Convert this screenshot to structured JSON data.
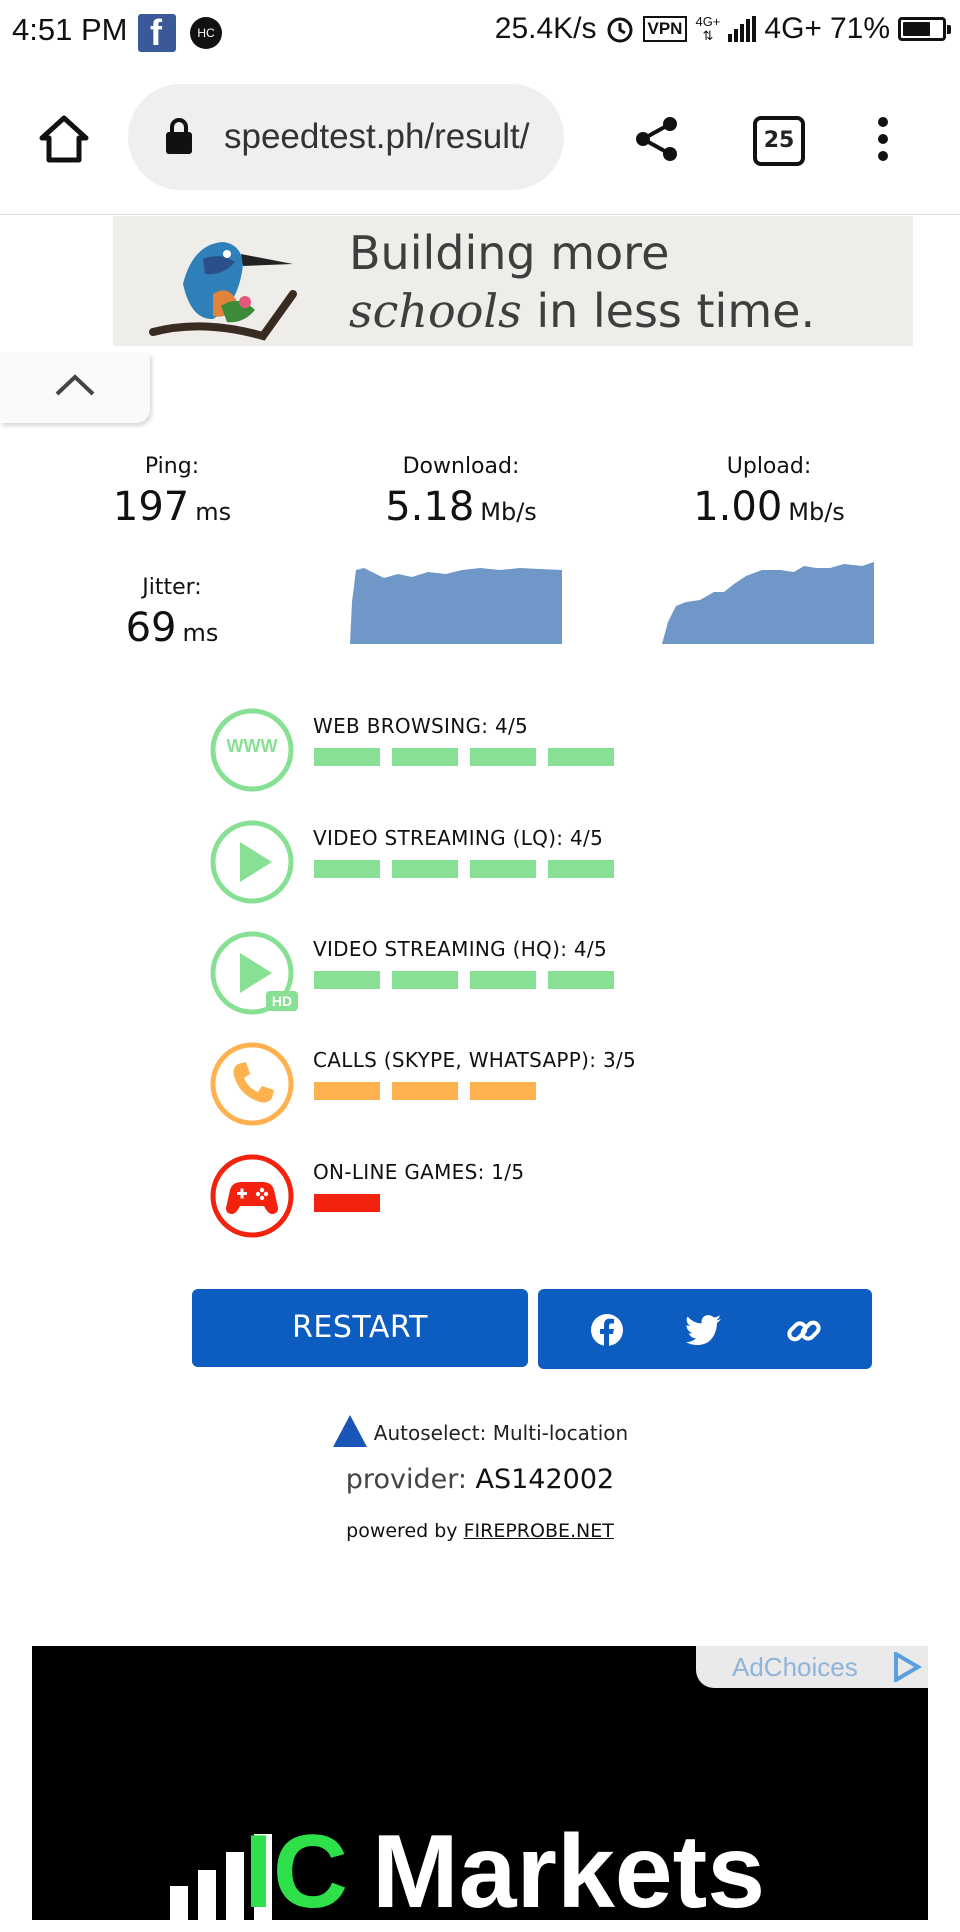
{
  "status_bar": {
    "time": "4:51 PM",
    "fb_letter": "f",
    "hc_badge": "HC",
    "net_speed": "25.4K/s",
    "vpn": "VPN",
    "small_4g": "4G+",
    "network": "4G+",
    "battery": "71%",
    "battery_level": 0.71
  },
  "browser": {
    "url": "speedtest.ph/result/",
    "tab_count": "25"
  },
  "banner_ad": {
    "line1": "Building more",
    "line2_italic": "schools",
    "line2_rest": " in less time."
  },
  "metrics": {
    "ping": {
      "label": "Ping:",
      "value": "197",
      "unit": "ms"
    },
    "jitter": {
      "label": "Jitter:",
      "value": "69",
      "unit": "ms"
    },
    "download": {
      "label": "Download:",
      "value": "5.18",
      "unit": "Mb/s"
    },
    "upload": {
      "label": "Upload:",
      "value": "1.00",
      "unit": "Mb/s"
    }
  },
  "ratings": [
    {
      "title": "WEB BROWSING: 4/5",
      "score": 4,
      "color": "#88e094",
      "icon": "www-icon",
      "icon_text": "WWW"
    },
    {
      "title": "VIDEO STREAMING (LQ): 4/5",
      "score": 4,
      "color": "#88e094",
      "icon": "play-icon"
    },
    {
      "title": "VIDEO STREAMING (HQ): 4/5",
      "score": 4,
      "color": "#88e094",
      "icon": "play-hd-icon",
      "badge": "HD"
    },
    {
      "title": "CALLS (SKYPE, WHATSAPP): 3/5",
      "score": 3,
      "color": "#fdb14f",
      "icon": "phone-icon"
    },
    {
      "title": "ON-LINE GAMES: 1/5",
      "score": 1,
      "color": "#f2220e",
      "icon": "gamepad-icon"
    }
  ],
  "actions": {
    "restart": "RESTART",
    "share_icons": [
      "facebook-icon",
      "twitter-icon",
      "link-icon"
    ]
  },
  "server": {
    "location": "Autoselect: Multi-location",
    "provider_label": "provider:",
    "provider_value": "AS142002",
    "powered_by": "powered by",
    "powered_link": "FIREPROBE.NET"
  },
  "bottom_ad": {
    "adchoices": "AdChoices",
    "brand_ic": "IC",
    "brand_markets": "Markets"
  },
  "colors": {
    "primary_blue": "#0d5cbf",
    "graph_fill": "#6f97c8",
    "green": "#88e094",
    "orange": "#fdb14f",
    "red": "#f2220e"
  }
}
